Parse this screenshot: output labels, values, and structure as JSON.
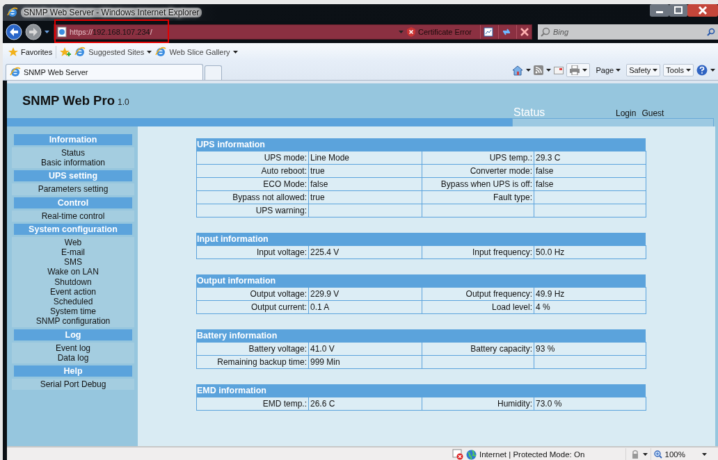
{
  "window": {
    "title": "SNMP Web Server - Windows Internet Explorer"
  },
  "address_bar": {
    "scheme": "https://",
    "host": "192.168.107.234",
    "trail": "/",
    "certificate_error": "Certificate Error"
  },
  "search": {
    "placeholder": "Bing"
  },
  "favorites_bar": {
    "favorites": "Favorites",
    "links": [
      "Suggested Sites",
      "Web Slice Gallery"
    ]
  },
  "tabs": [
    {
      "label": "SNMP Web Server"
    }
  ],
  "command_bar": [
    "Page",
    "Safety",
    "Tools"
  ],
  "page": {
    "title": "SNMP Web Pro",
    "version": "1.0",
    "current_page": "Status",
    "login": "Login",
    "user": "Guest",
    "sidebar": [
      {
        "title": "Information",
        "items": [
          "Status",
          "Basic information"
        ]
      },
      {
        "title": "UPS setting",
        "items": [
          "Parameters setting"
        ]
      },
      {
        "title": "Control",
        "items": [
          "Real-time control"
        ]
      },
      {
        "title": "System configuration",
        "items": [
          "Web",
          "E-mail",
          "SMS",
          "Wake on LAN",
          "Shutdown",
          "Event action",
          "Scheduled",
          "System time",
          "SNMP configuration"
        ]
      },
      {
        "title": "Log",
        "items": [
          "Event log",
          "Data log"
        ]
      },
      {
        "title": "Help",
        "items": [
          "Serial Port Debug"
        ]
      }
    ],
    "sections": [
      {
        "title": "UPS information",
        "rows": [
          [
            {
              "label": "UPS mode:",
              "value": "Line Mode"
            },
            {
              "label": "UPS temp.:",
              "value": "29.3 C"
            }
          ],
          [
            {
              "label": "Auto reboot:",
              "value": "true"
            },
            {
              "label": "Converter mode:",
              "value": "false"
            }
          ],
          [
            {
              "label": "ECO Mode:",
              "value": "false"
            },
            {
              "label": "Bypass when UPS is off:",
              "value": "false"
            }
          ],
          [
            {
              "label": "Bypass not allowed:",
              "value": "true"
            },
            {
              "label": "Fault type:"
            }
          ],
          [
            {
              "label": "UPS warning:"
            }
          ]
        ]
      },
      {
        "title": "Input information",
        "rows": [
          [
            {
              "label": "Input voltage:",
              "value": "225.4 V"
            },
            {
              "label": "Input frequency:",
              "value": "50.0 Hz"
            }
          ]
        ]
      },
      {
        "title": "Output information",
        "rows": [
          [
            {
              "label": "Output voltage:",
              "value": "229.9 V"
            },
            {
              "label": "Output frequency:",
              "value": "49.9 Hz"
            }
          ],
          [
            {
              "label": "Output current:",
              "value": "0.1 A"
            },
            {
              "label": "Load level:",
              "value": "4 %"
            }
          ]
        ]
      },
      {
        "title": "Battery information",
        "rows": [
          [
            {
              "label": "Battery voltage:",
              "value": "41.0 V"
            },
            {
              "label": "Battery capacity:",
              "value": "93 %"
            }
          ],
          [
            {
              "label": "Remaining backup time:",
              "value": "999 Min"
            }
          ]
        ]
      },
      {
        "title": "EMD information",
        "rows": [
          [
            {
              "label": "EMD temp.:",
              "value": "26.6 C"
            },
            {
              "label": "Humidity:",
              "value": "73.0 %"
            }
          ]
        ]
      }
    ]
  },
  "status_bar": {
    "zone": "Internet | Protected Mode: On",
    "zoom": "100%"
  }
}
